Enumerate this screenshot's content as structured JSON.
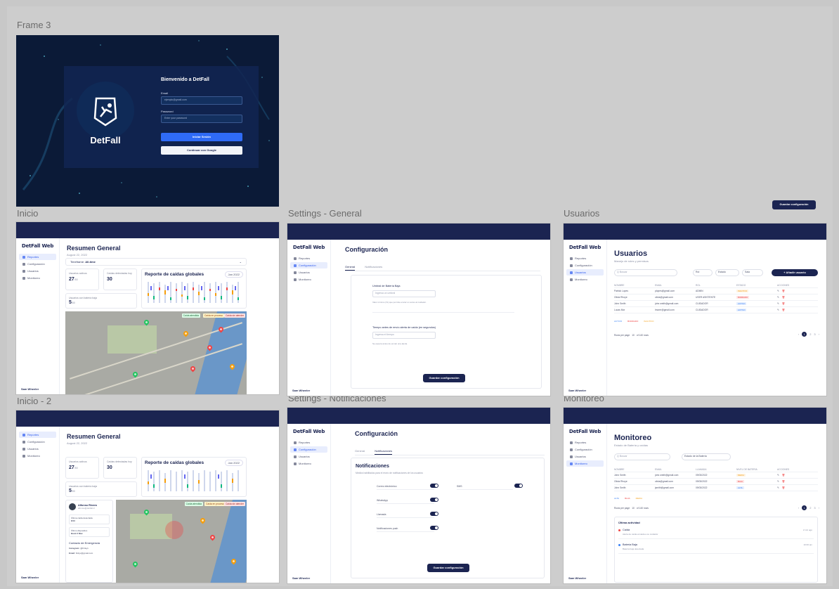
{
  "canvas_title": "Frame 3",
  "frames": {
    "inicio": "Inicio",
    "settings_general": "Settings - General",
    "usuarios": "Usuarios",
    "inicio2": "Inicio - 2",
    "settings_notif": "Settings - Notificaciones",
    "monitoreo": "Monitoreo"
  },
  "floating_save_button": "Guardar configuración",
  "login": {
    "brand": "DetFall",
    "title": "Bienvenido a DetFall",
    "email_label": "Email",
    "email_value": "ejemplo@gmail.com",
    "password_label": "Password",
    "password_placeholder": "Enter your password",
    "submit": "Iniciar Sesión",
    "google": "Continuar con Google"
  },
  "app": {
    "brand": "DetFall Web",
    "nav": [
      "Reportes",
      "Configuración",
      "Usuarios",
      "Monitoreo"
    ],
    "user_name": "Sam Wheeler"
  },
  "inicio": {
    "title": "Resumen General",
    "date": "August 22, 2022",
    "timeframe_label": "Timeframe:",
    "timeframe_value": "All-time",
    "stats": [
      {
        "label": "Usuarios activos",
        "value": "27",
        "unit": "/50"
      },
      {
        "label": "Caídas detectadas hoy",
        "value": "30",
        "unit": ""
      },
      {
        "label": "Usuarios con batería baja",
        "value": "5",
        "unit": "/50"
      }
    ],
    "chart_title": "Reporte de caídas globales",
    "chart_filter": "Jan 2022",
    "map_legend": [
      "Caída atendida",
      "Caída en proceso",
      "Caída sin atender"
    ]
  },
  "inicio2": {
    "title": "Resumen General",
    "date": "August 22, 2022",
    "profile_name": "Alfonso Rivera",
    "profile_email": "alfonso@detfall.cl",
    "last_fall_label": "Última caída detectada",
    "last_fall_value": "8/13",
    "device_label": "Último dispositivo",
    "device_value": "Band 3 Max",
    "contact_title": "Contacto de Emergencia",
    "contact_instagram_label": "Instagram:",
    "contact_instagram_value": "@Finkyx",
    "contact_email_label": "Email:",
    "contact_email_value": "finkyx@gmail.com"
  },
  "settings": {
    "title": "Configuración",
    "tab_general": "General",
    "tab_notifications": "Notificaciones",
    "battery_label": "Umbral de Batería Baja",
    "battery_placeholder": "Ingresa un umbral",
    "battery_hint": "Valor mínimo (%) que permite enviar un aviso al cuidador.",
    "wait_label": "Tiempo antes de envío alerta de caída (en segundos)",
    "wait_placeholder": "Ingresa el tiempo",
    "wait_hint": "Se espera antes de enviar una alerta.",
    "save": "Guardar configuración"
  },
  "notifications": {
    "title": "Notificaciones",
    "subtitle": "Medios habilitados para el envío de notificaciones de los usuarios",
    "options": [
      "Correo electrónico",
      "WhatsApp",
      "Llamada",
      "Notificaciones push"
    ],
    "option_right": "SMS",
    "save": "Guardar configuración"
  },
  "usuarios": {
    "title": "Usuarios",
    "subtitle": "Manejo de roles y permisos",
    "search_placeholder": "Q Buscar",
    "filters": [
      "Rol",
      "Estado",
      "Sala"
    ],
    "add_button": "+ Añadir usuario",
    "columns": [
      "NOMBRE",
      "EMAIL",
      "ROL",
      "ESTADO",
      "ACCIONES"
    ],
    "rows": [
      {
        "name": "Patrick Lopes",
        "email": "plopes@gmail.com",
        "role": "ADMIN",
        "status": "INACTIVO",
        "status_color": "#f5a524"
      },
      {
        "name": "Olivia Rhoye",
        "email": "olivia@gmail.com",
        "role": "USER ASISTENTE",
        "status": "BORRADO",
        "status_color": "#ef4444"
      },
      {
        "name": "John Smith",
        "email": "john.smith@gmail.com",
        "role": "CUIDADOR",
        "status": "ACTIVO",
        "status_color": "#3b82f6"
      },
      {
        "name": "Lucas Mor",
        "email": "lmorer@gmail.com",
        "role": "CUIDADOR",
        "status": "ACTIVO",
        "status_color": "#3b82f6"
      }
    ],
    "legend": [
      "ACTIVO",
      "BORRADO",
      "INACTIVO"
    ],
    "rows_per_page": "Rows per page",
    "rows_value": "10",
    "range": "of 140 rows"
  },
  "monitoreo": {
    "title": "Monitoreo",
    "subtitle": "Estado de Batería y caídas",
    "search_placeholder": "Q Buscar",
    "filter": "Estado de la Batería",
    "columns": [
      "NOMBRE",
      "EMAIL",
      "LLAMADA",
      "NIVEL DE BATERÍA",
      "ACCIONES"
    ],
    "rows": [
      {
        "name": "John Smith",
        "email": "john.smith@gmail.com",
        "date": "09/03/2022",
        "level": "MEDIA",
        "color": "#f5a524"
      },
      {
        "name": "Olivia Rhoye",
        "email": "olivia@gmail.com",
        "date": "09/03/2022",
        "level": "BAJA",
        "color": "#ef4444"
      },
      {
        "name": "John Smith",
        "email": "jsmith@gmail.com",
        "date": "09/03/2022",
        "level": "ALTA",
        "color": "#3b82f6"
      }
    ],
    "legend": [
      "ALTA",
      "BAJA",
      "MEDIA"
    ],
    "rows_per_page": "Rows per page",
    "rows_value": "10",
    "range": "of 140 rows",
    "activity_title": "Última actividad",
    "activity": [
      {
        "label": "Caída",
        "time": "2 min ago",
        "text": "Alerta de caída enviada a su cuidador",
        "color": "#ef4444"
      },
      {
        "label": "Batería Baja",
        "time": "10:00 am",
        "text": "Batería baja detectada",
        "color": "#3b82f6"
      }
    ]
  }
}
